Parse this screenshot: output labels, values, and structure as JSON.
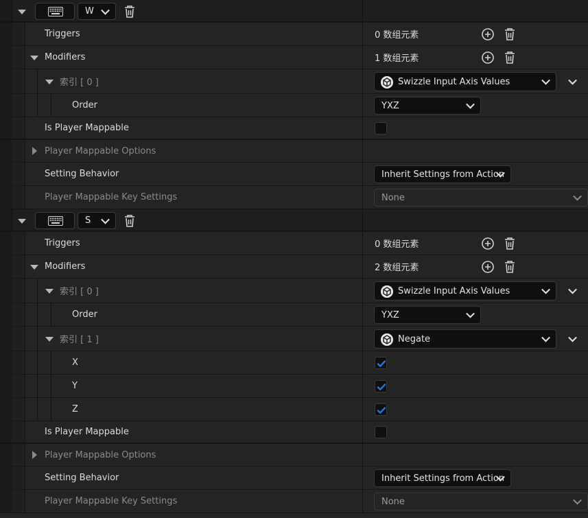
{
  "mappings": [
    {
      "key": "W",
      "triggers": {
        "label": "Triggers",
        "count": "0 数组元素"
      },
      "modifiers": {
        "label": "Modifiers",
        "count": "1 数组元素"
      },
      "modifier_items": [
        {
          "index_label": "索引 [ 0 ]",
          "type": "Swizzle Input Axis Values",
          "props": [
            {
              "name": "Order",
              "value": "YXZ",
              "kind": "dropdown"
            }
          ]
        }
      ],
      "is_player_mappable": {
        "label": "Is Player Mappable",
        "checked": false
      },
      "player_mappable_options": "Player Mappable Options",
      "setting_behavior": {
        "label": "Setting Behavior",
        "value": "Inherit Settings from Action"
      },
      "key_settings": {
        "label": "Player Mappable Key Settings",
        "value": "None"
      }
    },
    {
      "key": "S",
      "triggers": {
        "label": "Triggers",
        "count": "0 数组元素"
      },
      "modifiers": {
        "label": "Modifiers",
        "count": "2 数组元素"
      },
      "modifier_items": [
        {
          "index_label": "索引 [ 0 ]",
          "type": "Swizzle Input Axis Values",
          "props": [
            {
              "name": "Order",
              "value": "YXZ",
              "kind": "dropdown"
            }
          ]
        },
        {
          "index_label": "索引 [ 1 ]",
          "type": "Negate",
          "props": [
            {
              "name": "X",
              "checked": true,
              "kind": "check"
            },
            {
              "name": "Y",
              "checked": true,
              "kind": "check"
            },
            {
              "name": "Z",
              "checked": true,
              "kind": "check"
            }
          ]
        }
      ],
      "is_player_mappable": {
        "label": "Is Player Mappable",
        "checked": false
      },
      "player_mappable_options": "Player Mappable Options",
      "setting_behavior": {
        "label": "Setting Behavior",
        "value": "Inherit Settings from Action"
      },
      "key_settings": {
        "label": "Player Mappable Key Settings",
        "value": "None"
      }
    }
  ],
  "colors": {
    "accent_check": "#1f7ae0",
    "panel": "#242424",
    "field": "#0f0f0f"
  },
  "icons": {
    "keyboard": "keyboard-icon",
    "add": "add-circle-icon",
    "delete": "trash-icon",
    "modifier": "modifier-cube-icon"
  }
}
